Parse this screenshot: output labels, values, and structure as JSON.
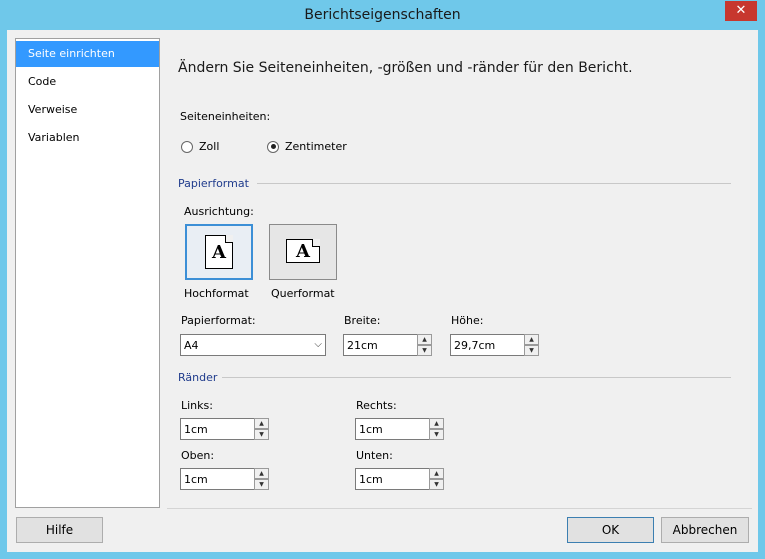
{
  "window": {
    "title": "Berichtseigenschaften",
    "close_glyph": "✕"
  },
  "nav": {
    "items": [
      {
        "label": "Seite einrichten",
        "selected": true
      },
      {
        "label": "Code",
        "selected": false
      },
      {
        "label": "Verweise",
        "selected": false
      },
      {
        "label": "Variablen",
        "selected": false
      }
    ]
  },
  "content": {
    "heading": "Ändern Sie Seiteneinheiten, -größen und -ränder für den Bericht.",
    "units_label": "Seiteneinheiten:",
    "units": {
      "inch": {
        "label": "Zoll",
        "checked": false
      },
      "cm": {
        "label": "Zentimeter",
        "checked": true
      }
    },
    "paper_group": "Papierformat",
    "orientation_label": "Ausrichtung:",
    "portrait": {
      "label": "Hochformat",
      "icon": "portrait-page-icon",
      "letter": "A",
      "active": true
    },
    "landscape": {
      "label": "Querformat",
      "icon": "landscape-page-icon",
      "letter": "A",
      "active": false
    },
    "paper_format": {
      "label": "Papierformat:",
      "value": "A4",
      "arrow": "⌵"
    },
    "width": {
      "label": "Breite:",
      "value": "21cm"
    },
    "height": {
      "label": "Höhe:",
      "value": "29,7cm"
    },
    "margins_group": "Ränder",
    "left": {
      "label": "Links:",
      "value": "1cm"
    },
    "right": {
      "label": "Rechts:",
      "value": "1cm"
    },
    "top": {
      "label": "Oben:",
      "value": "1cm"
    },
    "bottom": {
      "label": "Unten:",
      "value": "1cm"
    },
    "spin_up": "▲",
    "spin_down": "▼"
  },
  "footer": {
    "help": "Hilfe",
    "ok": "OK",
    "cancel": "Abbrechen"
  },
  "colors": {
    "accent": "#3399ff",
    "titlebar": "#6fc8ea",
    "close": "#c7372e",
    "group_title": "#1f3b8c"
  }
}
